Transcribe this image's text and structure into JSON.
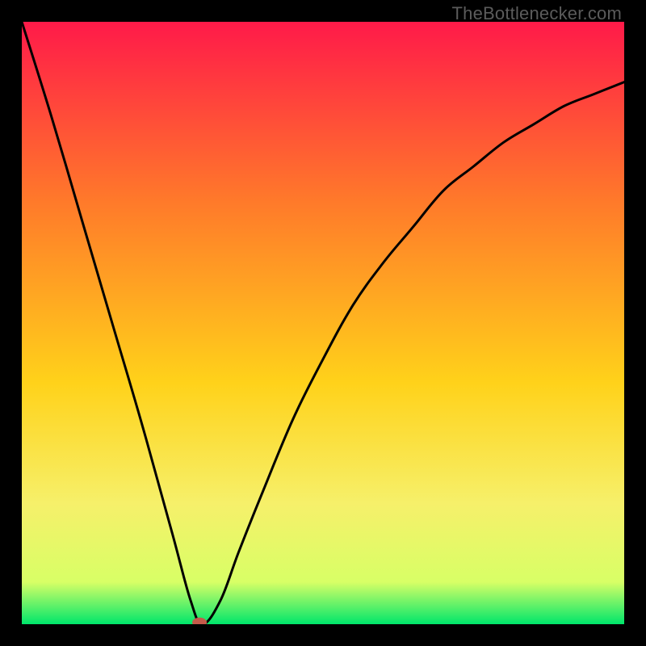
{
  "watermark": "TheBottlenecker.com",
  "colors": {
    "frame": "#000000",
    "gradient_top": "#ff1a49",
    "gradient_mid_upper": "#ff7a2a",
    "gradient_mid": "#ffd21a",
    "gradient_lower": "#f6f06a",
    "gradient_near_bottom": "#d8ff66",
    "gradient_bottom": "#00e66b",
    "curve": "#000000",
    "marker": "#c45a4a"
  },
  "chart_data": {
    "type": "line",
    "title": "",
    "xlabel": "",
    "ylabel": "",
    "xlim": [
      0,
      100
    ],
    "ylim": [
      0,
      100
    ],
    "series": [
      {
        "name": "bottleneck-curve",
        "x": [
          0,
          5,
          10,
          15,
          20,
          25,
          28,
          30,
          33,
          36,
          40,
          45,
          50,
          55,
          60,
          65,
          70,
          75,
          80,
          85,
          90,
          95,
          100
        ],
        "y": [
          100,
          84,
          67,
          50,
          33,
          15,
          4,
          0,
          4,
          12,
          22,
          34,
          44,
          53,
          60,
          66,
          72,
          76,
          80,
          83,
          86,
          88,
          90
        ]
      }
    ],
    "annotations": [
      {
        "name": "optimal-marker",
        "x": 29.5,
        "y": 0.3
      }
    ]
  }
}
